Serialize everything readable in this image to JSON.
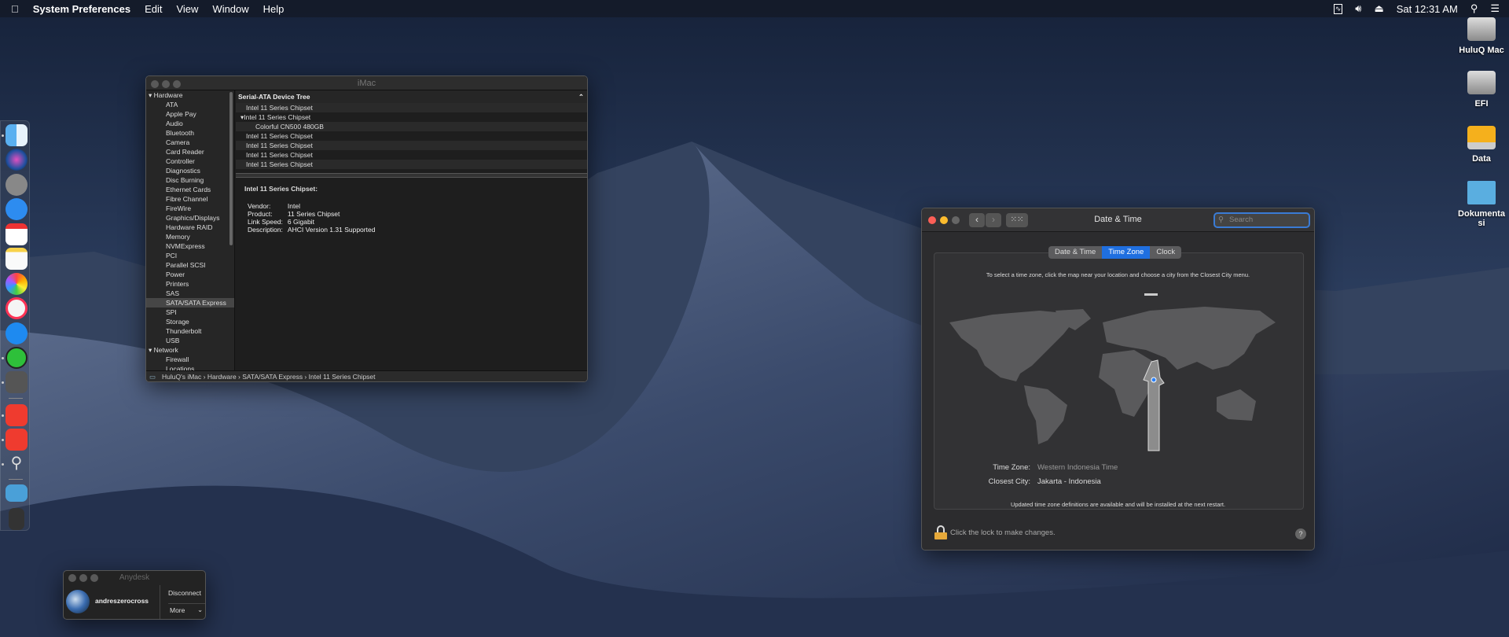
{
  "menubar": {
    "apple": "",
    "app": "System Preferences",
    "items": [
      "Edit",
      "View",
      "Window",
      "Help"
    ],
    "clock": "Sat 12:31 AM"
  },
  "desktop_icons": [
    {
      "label": "HuluQ Mac",
      "icon": "hard-drive-icon"
    },
    {
      "label": "EFI",
      "icon": "hard-drive-icon"
    },
    {
      "label": "Data",
      "icon": "external-drive-icon"
    },
    {
      "label": "Dokumenta si",
      "icon": "folder-icon"
    }
  ],
  "dock": [
    "finder",
    "siri",
    "launchpad",
    "safari",
    "calendar",
    "notes",
    "photos",
    "itunes",
    "app-store",
    "green-app",
    "system-preferences",
    "anydesk",
    "anydesk",
    "system-information",
    "downloads-folder",
    "trash"
  ],
  "sysinfo": {
    "title": "iMac",
    "sidebar": [
      {
        "label": "Hardware",
        "header": true
      },
      {
        "label": "ATA"
      },
      {
        "label": "Apple Pay"
      },
      {
        "label": "Audio"
      },
      {
        "label": "Bluetooth"
      },
      {
        "label": "Camera"
      },
      {
        "label": "Card Reader"
      },
      {
        "label": "Controller"
      },
      {
        "label": "Diagnostics"
      },
      {
        "label": "Disc Burning"
      },
      {
        "label": "Ethernet Cards"
      },
      {
        "label": "Fibre Channel"
      },
      {
        "label": "FireWire"
      },
      {
        "label": "Graphics/Displays"
      },
      {
        "label": "Hardware RAID"
      },
      {
        "label": "Memory"
      },
      {
        "label": "NVMExpress"
      },
      {
        "label": "PCI"
      },
      {
        "label": "Parallel SCSI"
      },
      {
        "label": "Power"
      },
      {
        "label": "Printers"
      },
      {
        "label": "SAS"
      },
      {
        "label": "SATA/SATA Express",
        "selected": true
      },
      {
        "label": "SPI"
      },
      {
        "label": "Storage"
      },
      {
        "label": "Thunderbolt"
      },
      {
        "label": "USB"
      },
      {
        "label": "Network",
        "header": true
      },
      {
        "label": "Firewall"
      },
      {
        "label": "Locations"
      }
    ],
    "tree_header": "Serial-ATA Device Tree",
    "tree": [
      {
        "label": "Intel 11 Series Chipset"
      },
      {
        "label": "Intel 11 Series Chipset",
        "expanded": true
      },
      {
        "label": "Colorful CN500 480GB",
        "sub": true
      },
      {
        "label": "Intel 11 Series Chipset"
      },
      {
        "label": "Intel 11 Series Chipset"
      },
      {
        "label": "Intel 11 Series Chipset"
      },
      {
        "label": "Intel 11 Series Chipset"
      }
    ],
    "detail": {
      "title": "Intel 11 Series Chipset:",
      "rows": [
        [
          "Vendor:",
          "Intel"
        ],
        [
          "Product:",
          "11 Series Chipset"
        ],
        [
          "Link Speed:",
          "6 Gigabit"
        ],
        [
          "Description:",
          "AHCI Version 1.31 Supported"
        ]
      ]
    },
    "breadcrumb": "HuluQ's iMac  ›  Hardware  ›  SATA/SATA Express  ›  Intel 11 Series Chipset"
  },
  "datetime": {
    "title": "Date & Time",
    "search_placeholder": "Search",
    "tabs": [
      {
        "label": "Date & Time"
      },
      {
        "label": "Time Zone",
        "active": true
      },
      {
        "label": "Clock"
      }
    ],
    "instruction": "To select a time zone, click the map near your location and choose a city from the Closest City menu.",
    "time_zone_label": "Time Zone:",
    "time_zone": "Western Indonesia Time",
    "closest_city_label": "Closest City:",
    "closest_city": "Jakarta - Indonesia",
    "update_note": "Updated time zone definitions are available and will be installed at the next restart.",
    "lock_text": "Click the lock to make changes.",
    "help": "?"
  },
  "anydesk": {
    "title": "Anydesk",
    "user": "andreszerocross",
    "disconnect": "Disconnect",
    "more": "More"
  }
}
